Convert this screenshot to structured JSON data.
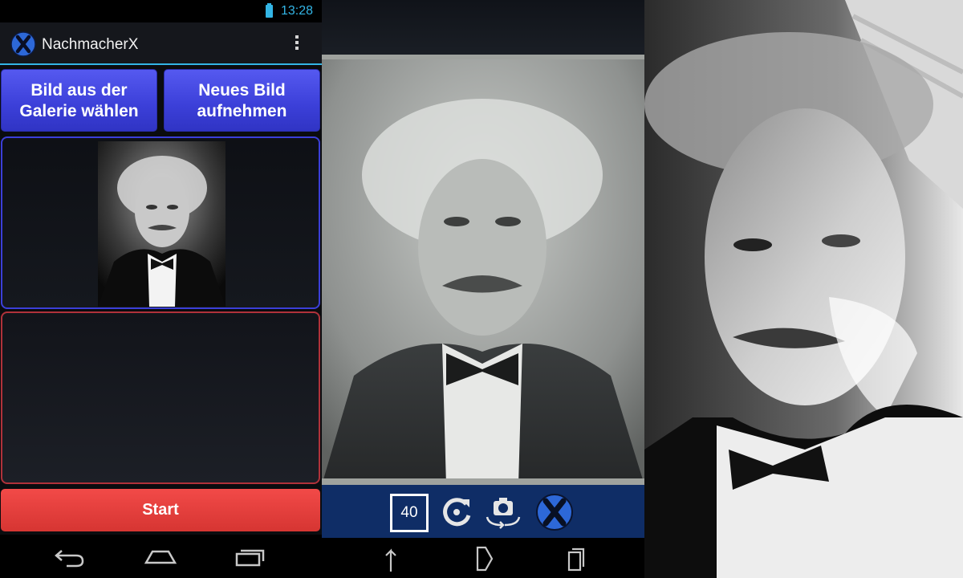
{
  "status_bar": {
    "time": "13:28"
  },
  "app": {
    "title": "NachmacherX"
  },
  "buttons": {
    "gallery_line1": "Bild aus der",
    "gallery_line2": "Galerie wählen",
    "camera_line1": "Neues Bild",
    "camera_line2": "aufnehmen",
    "start": "Start"
  },
  "icons": {
    "app_logo": "x-logo-icon",
    "overflow": "overflow-menu-icon",
    "battery": "battery-icon",
    "nav_back": "back-icon",
    "nav_home": "home-icon",
    "nav_recent": "recent-apps-icon",
    "rotate": "rotate-icon",
    "switch_camera": "switch-camera-icon",
    "capture": "x-logo-icon",
    "nav_up": "arrow-up-icon",
    "nav_right": "chevron-right-icon",
    "nav_docs": "documents-icon"
  },
  "camera": {
    "counter": "40"
  },
  "colors": {
    "accent_blue": "#33b5e5",
    "button_blue": "#3b3fd8",
    "start_red": "#e0403d",
    "toolbar_navy": "#0f2d66"
  }
}
